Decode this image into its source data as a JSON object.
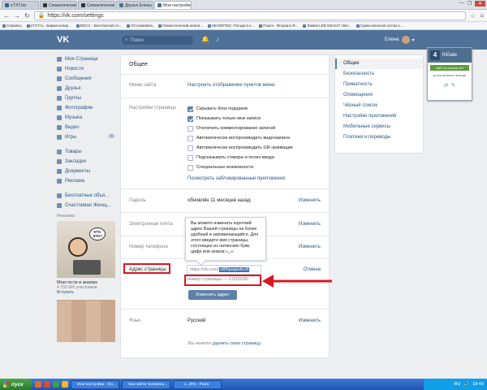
{
  "browser": {
    "tabs": [
      {
        "label": "eTXT.biz",
        "color": "#3a5f8f",
        "active": false
      },
      {
        "label": "Семантический анализ те",
        "color": "#333",
        "active": false
      },
      {
        "label": "Семантический анализ те",
        "color": "#333",
        "active": false
      },
      {
        "label": "Друзья Елены Шевцовой",
        "color": "#507299",
        "active": false
      },
      {
        "label": "Мои настройки",
        "color": "#507299",
        "active": true
      }
    ],
    "window_controls": [
      "—",
      "❐",
      "✕"
    ],
    "url": "https://vk.com/settings",
    "bookmarks": [
      "Сервисы",
      "eTXT.ru - Биржа копир...",
      "ВОСС - Бесплатная сл...",
      "Отслеживать",
      "Семантический анали...",
      "SEVERTEK: Погода в н...",
      "Поиск - Флоранс Ф...",
      "Лампа LED 5W E27 свет...",
      "Сумка женская оптом 1..."
    ]
  },
  "vk_header": {
    "logo": "VK",
    "search_placeholder": "Поиск",
    "user_name": "Елена"
  },
  "sidebar": {
    "items": [
      {
        "label": "Моя Страница",
        "icon": "home-icon"
      },
      {
        "label": "Новости",
        "icon": "news-icon"
      },
      {
        "label": "Сообщения",
        "icon": "message-icon"
      },
      {
        "label": "Друзья",
        "icon": "friends-icon"
      },
      {
        "label": "Группы",
        "icon": "groups-icon"
      },
      {
        "label": "Фотографии",
        "icon": "photo-icon"
      },
      {
        "label": "Музыка",
        "icon": "music-icon"
      },
      {
        "label": "Видео",
        "icon": "video-icon"
      },
      {
        "label": "Игры",
        "icon": "games-icon",
        "count": "36"
      }
    ],
    "items2": [
      {
        "label": "Товары",
        "icon": "goods-icon"
      },
      {
        "label": "Закладки",
        "icon": "bookmark-icon"
      },
      {
        "label": "Документы",
        "icon": "docs-icon"
      },
      {
        "label": "Реклама",
        "icon": "ads-icon"
      }
    ],
    "items3": [
      {
        "label": "Бесплатные объя...",
        "icon": "app-icon"
      },
      {
        "label": "Счастливая Женщ...",
        "icon": "app-icon"
      }
    ],
    "ad_label": "Реклама",
    "ad_bubble": "КТО ЭТО?",
    "ad_title": "Мои гости и анализ",
    "ad_subtitle": "4 700 000 участников",
    "ad_join": "Вступить"
  },
  "settings": {
    "heading": "Общее",
    "menu_label": "Меню сайта",
    "menu_value": "Настроить отображение пунктов меню",
    "page_settings_label": "Настройки страницы",
    "checkboxes": [
      {
        "label": "Скрывать блок подарков",
        "checked": true
      },
      {
        "label": "Показывать только мои записи",
        "checked": true
      },
      {
        "label": "Отключить комментирование записей",
        "checked": false
      },
      {
        "label": "Автоматически воспроизводить видеозаписи",
        "checked": false
      },
      {
        "label": "Автоматически воспроизводить GIF-анимации",
        "checked": false
      },
      {
        "label": "Подсказывать стикеры в полях ввода",
        "checked": false
      },
      {
        "label": "Специальные возможности",
        "checked": false
      }
    ],
    "blocked_apps_link": "Посмотреть заблокированные приложения",
    "password_label": "Пароль",
    "password_value": "обновлён 11 месяцев назад",
    "email_label": "Электронная почта",
    "phone_label": "Номер телефона",
    "change_label": "Изменить",
    "address_label": "Адрес страницы",
    "tooltip": "Вы можете изменить короткий адрес Вашей страницы на более удобный и запоминающийся. Для этого введите имя страницы, состоящее из латинских букв, цифр или знаков «_».",
    "address_prefix": "https://vk.com/",
    "address_value": "id56pagadoc8",
    "cancel_label": "Отмена",
    "page_number": "Номер страницы — 51500280",
    "save_button": "Изменить адрес",
    "language_label": "Язык",
    "language_value": "Русский",
    "delete_prefix": "Вы можете",
    "delete_link": "удалить свою страницу."
  },
  "right_nav": {
    "items": [
      "Общее",
      "Безопасность",
      "Приватность",
      "Оповещения",
      "Чёрный список",
      "Настройки приложений",
      "Мобильные сервисы",
      "Платежи и переводы"
    ]
  },
  "frigate": {
    "title": "friGate",
    "status": "сайт из списка нет",
    "proxy": "proxy включен всегда"
  },
  "taskbar": {
    "start": "пуск",
    "tasks": [
      "Мои настройки - Go...",
      "Как найти человека...",
      "2. JPG - Paint"
    ],
    "lang": "RU",
    "time": "18:43"
  },
  "colors": {
    "vk_blue": "#507299",
    "link": "#2a5885",
    "highlight_red": "#d8171f"
  }
}
